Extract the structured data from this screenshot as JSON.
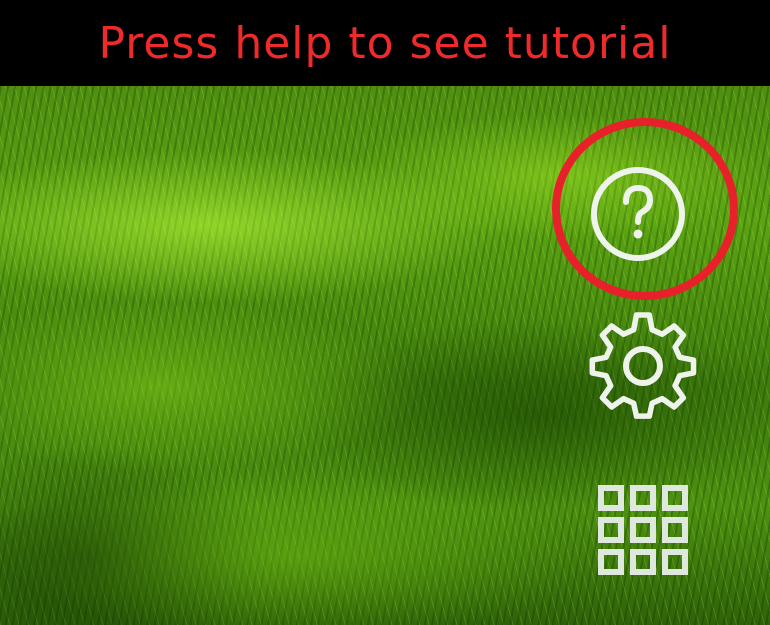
{
  "banner": {
    "text": "Press help to see tutorial"
  },
  "icons": {
    "help": "help-icon",
    "settings": "gear-icon",
    "apps": "apps-grid-icon"
  },
  "colors": {
    "banner_text": "#ee2a2a",
    "highlight_ring": "#e8202a",
    "icon_fill": "#eef3ec",
    "banner_background": "#000000"
  }
}
